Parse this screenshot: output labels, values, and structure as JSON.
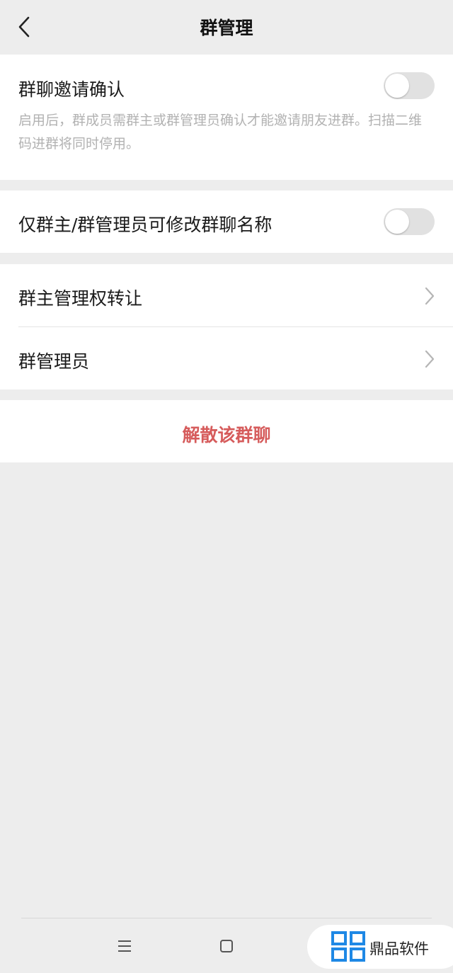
{
  "header": {
    "title": "群管理",
    "back_icon": "chevron-left-icon"
  },
  "invite_confirm": {
    "label": "群聊邀请确认",
    "toggle_on": false,
    "description": "启用后，群成员需群主或群管理员确认才能邀请朋友进群。扫描二维码进群将同时停用。"
  },
  "rename_restrict": {
    "label": "仅群主/群管理员可修改群聊名称",
    "toggle_on": false
  },
  "menu": {
    "transfer_owner": "群主管理权转让",
    "admins": "群管理员"
  },
  "dissolve": {
    "label": "解散该群聊",
    "color": "#d65c5c"
  },
  "system_nav": {
    "menu_icon": "menu-icon",
    "home_icon": "home-square-icon"
  },
  "watermark": {
    "text": "鼎品软件"
  },
  "colors": {
    "background": "#ededed",
    "card": "#ffffff",
    "toggle_off": "#e1e1e1",
    "secondary_text": "#b2b2b2"
  }
}
